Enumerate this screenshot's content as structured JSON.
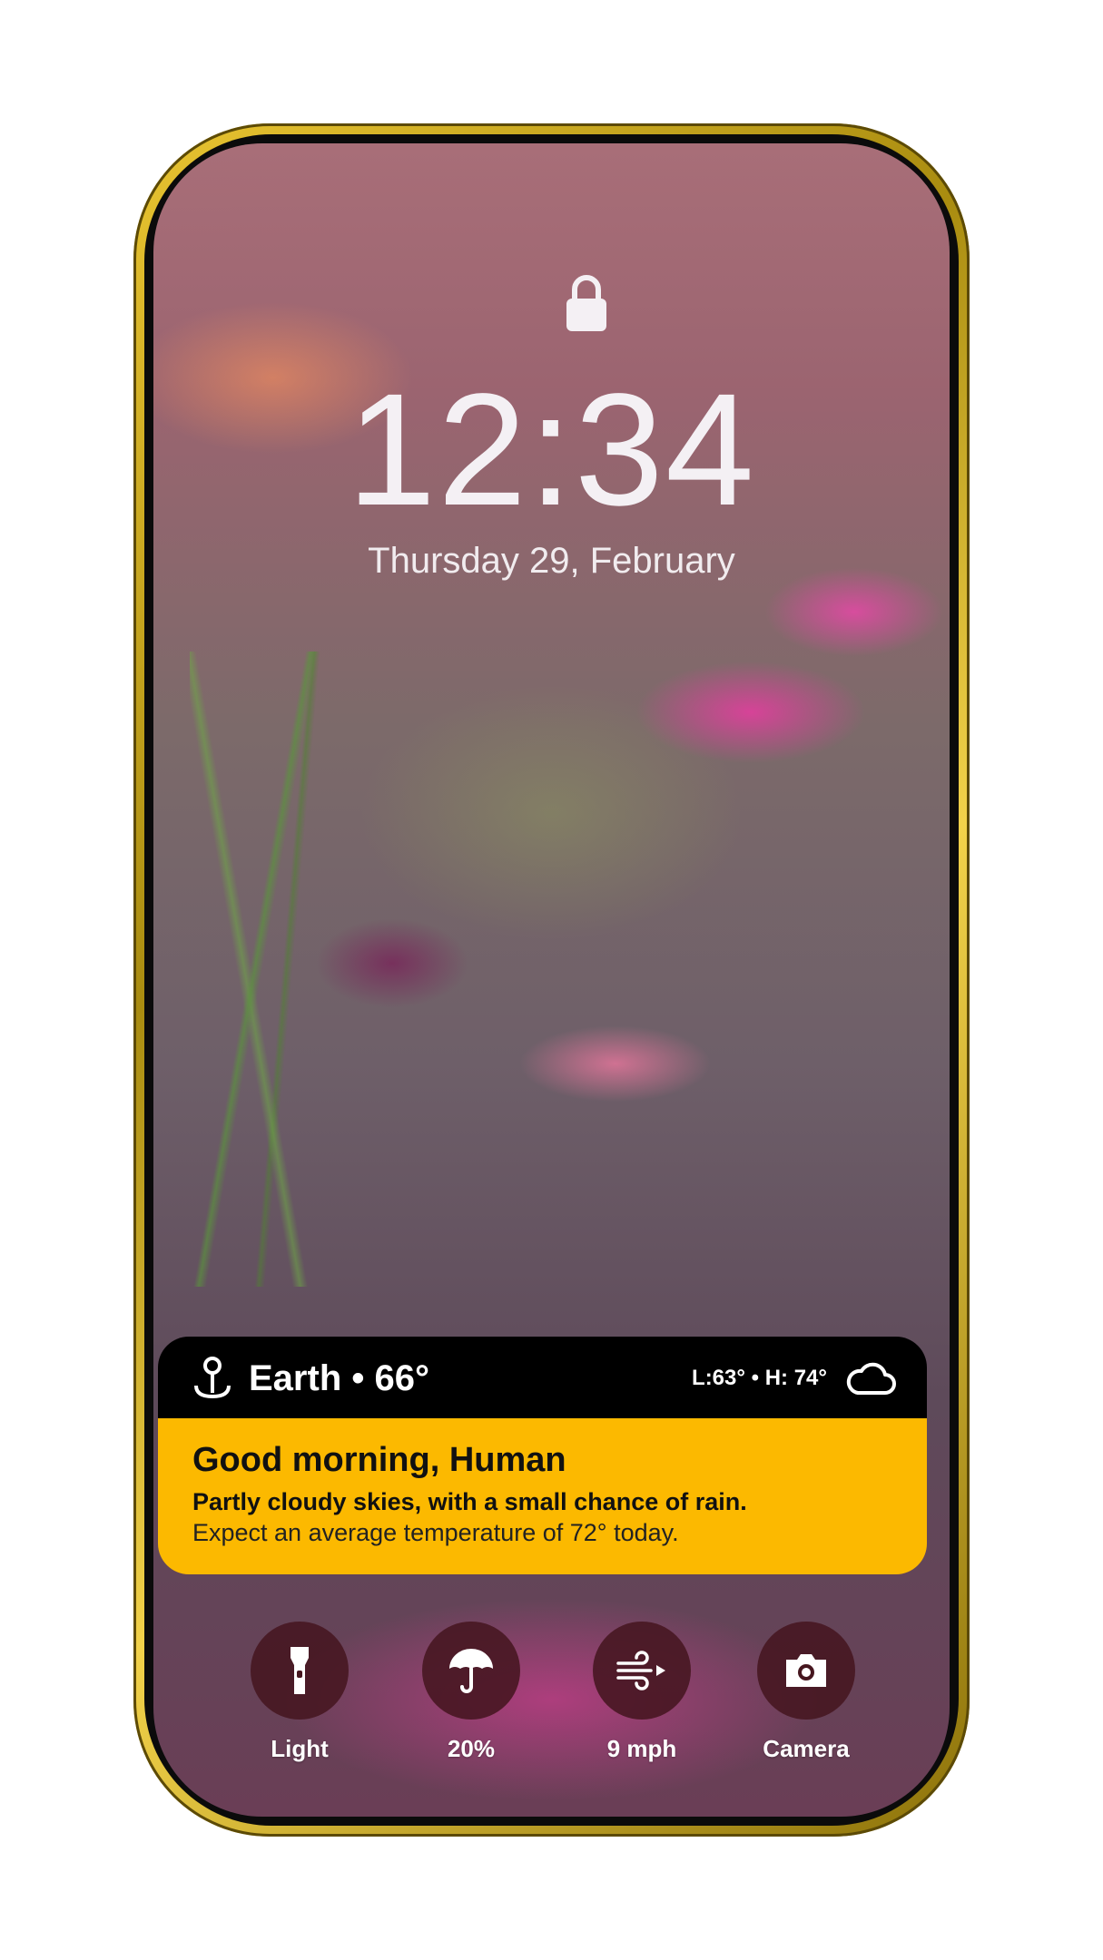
{
  "lockscreen": {
    "time": "12:34",
    "date": "Thursday 29, February"
  },
  "weather_widget": {
    "location": "Earth",
    "current_temp": "66°",
    "separator": "•",
    "low_high": "L:63° • H: 74°",
    "greeting": "Good morning, Human",
    "summary": "Partly cloudy skies, with a small chance of rain.",
    "detail": "Expect an average temperature of 72° today.",
    "accent_color": "#fcb900",
    "header_color": "#000000",
    "icons": [
      "location-pin-icon",
      "cloud-icon"
    ]
  },
  "shortcuts": [
    {
      "label": "Light",
      "icon": "flashlight-icon"
    },
    {
      "label": "20%",
      "icon": "umbrella-icon"
    },
    {
      "label": "9 mph",
      "icon": "wind-icon"
    },
    {
      "label": "Camera",
      "icon": "camera-icon"
    }
  ],
  "frame_color": "#d4b21e"
}
